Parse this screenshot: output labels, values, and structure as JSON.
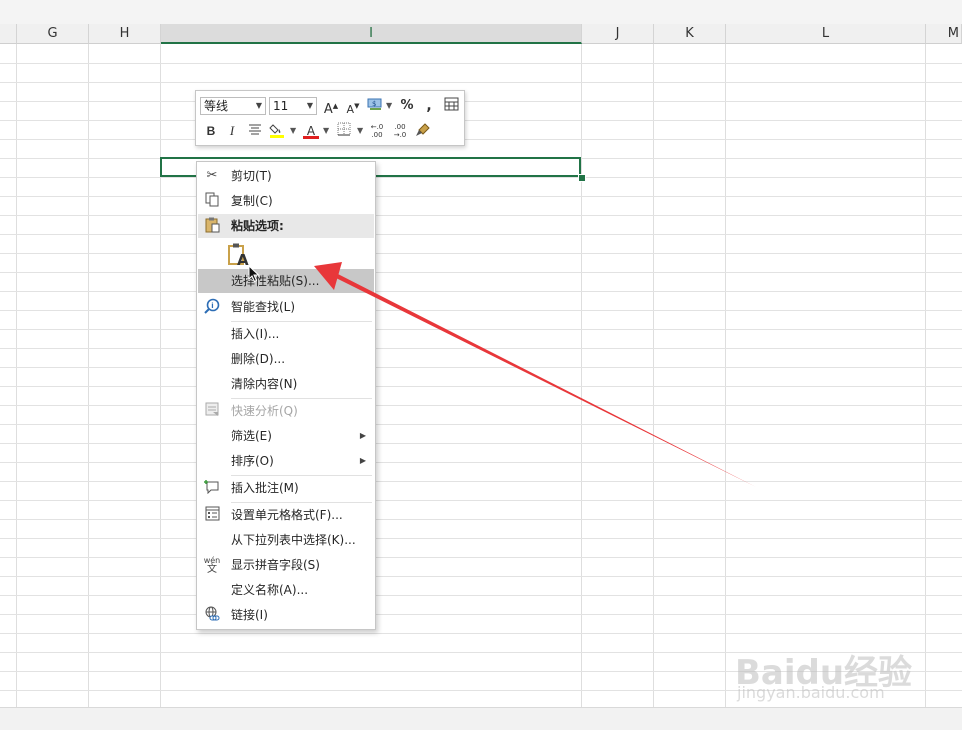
{
  "sheet": {
    "columns": [
      "G",
      "H",
      "I",
      "J",
      "K",
      "L",
      "M"
    ],
    "selected_column": "I"
  },
  "mini_toolbar": {
    "font_name": "等线",
    "font_size": "11",
    "grow_font": "A",
    "shrink_font": "A",
    "percent": "%",
    "comma": ",",
    "bold": "B",
    "italic": "I",
    "font_color_glyph": "A",
    "increase_decimal": "←.0\n.00",
    "decrease_decimal": ".00\n→.0"
  },
  "context_menu": {
    "items": [
      {
        "label": "剪切(T)",
        "icon": "scissors-icon"
      },
      {
        "label": "复制(C)",
        "icon": "copy-icon"
      },
      {
        "label": "粘贴选项:",
        "icon": "clipboard-icon"
      },
      {
        "label": "选择性粘贴(S)...",
        "icon": ""
      },
      {
        "label": "智能查找(L)",
        "icon": "smart-lookup-icon"
      },
      {
        "label": "插入(I)...",
        "icon": ""
      },
      {
        "label": "删除(D)...",
        "icon": ""
      },
      {
        "label": "清除内容(N)",
        "icon": ""
      },
      {
        "label": "快速分析(Q)",
        "icon": "quick-analysis-icon"
      },
      {
        "label": "筛选(E)",
        "icon": ""
      },
      {
        "label": "排序(O)",
        "icon": ""
      },
      {
        "label": "插入批注(M)",
        "icon": "comment-icon"
      },
      {
        "label": "设置单元格格式(F)...",
        "icon": "format-cells-icon"
      },
      {
        "label": "从下拉列表中选择(K)...",
        "icon": ""
      },
      {
        "label": "显示拼音字段(S)",
        "icon": "pinyin-icon"
      },
      {
        "label": "定义名称(A)...",
        "icon": ""
      },
      {
        "label": "链接(I)",
        "icon": "link-icon"
      }
    ],
    "paste_option_letter": "A",
    "pinyin_glyph_top": "wén",
    "pinyin_glyph_bottom": "文"
  },
  "watermark": {
    "logo": "Baidu经验",
    "url": "jingyan.baidu.com"
  },
  "colors": {
    "accent": "#217346",
    "arrow": "#e8373a"
  }
}
